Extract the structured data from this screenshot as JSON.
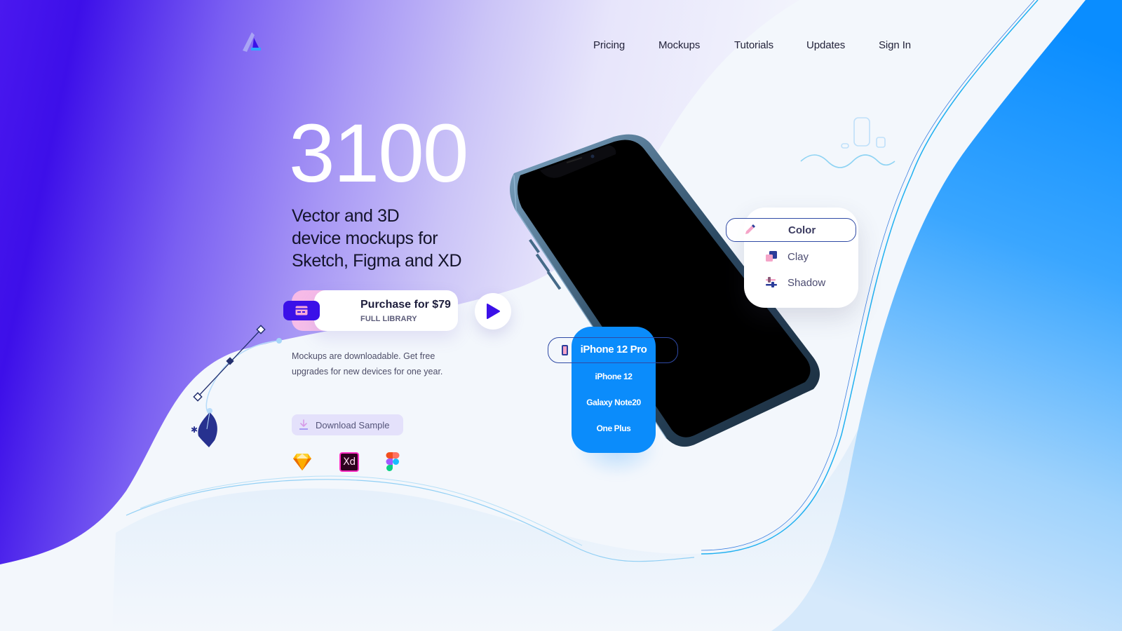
{
  "brand": {
    "logo_icon": "triangle-logo-icon",
    "colors": {
      "primary": "#3b10e8",
      "accent_blue": "#0b8cfb",
      "text_dark": "#1d1d35",
      "menu_outline": "#2f4aa5",
      "pink": "#f5a4c8",
      "background": "#f3f7fc"
    }
  },
  "nav": {
    "items": [
      {
        "label": "Pricing"
      },
      {
        "label": "Mockups"
      },
      {
        "label": "Tutorials"
      },
      {
        "label": "Updates"
      },
      {
        "label": "Sign In"
      }
    ]
  },
  "hero": {
    "count": "3100",
    "subtitle_lines": [
      "Vector and 3D",
      "device mockups for",
      "Sketch, Figma and XD"
    ],
    "purchase": {
      "icon": "credit-card-icon",
      "title": "Purchase for $79",
      "caption": "FULL LIBRARY"
    },
    "play_icon": "play-icon",
    "blurb_lines": [
      "Mockups are downloadable. Get free",
      "upgrades for new devices for one year."
    ],
    "download": {
      "icon": "download-icon",
      "label": "Download Sample"
    },
    "tools": [
      {
        "name": "Sketch",
        "icon": "sketch-icon"
      },
      {
        "name": "Adobe XD",
        "icon": "xd-icon",
        "label": "Xd"
      },
      {
        "name": "Figma",
        "icon": "figma-icon"
      }
    ]
  },
  "render_menu": {
    "items": [
      {
        "label": "Color",
        "icon": "pencil-icon",
        "active": true
      },
      {
        "label": "Clay",
        "icon": "clay-squares-icon",
        "active": false
      },
      {
        "label": "Shadow",
        "icon": "sliders-icon",
        "active": false
      }
    ]
  },
  "device_menu": {
    "icon": "phone-icon",
    "items": [
      {
        "label": "iPhone 12 Pro",
        "active": true
      },
      {
        "label": "iPhone 12",
        "active": false
      },
      {
        "label": "Galaxy Note20",
        "active": false
      },
      {
        "label": "One Plus",
        "active": false
      }
    ]
  }
}
